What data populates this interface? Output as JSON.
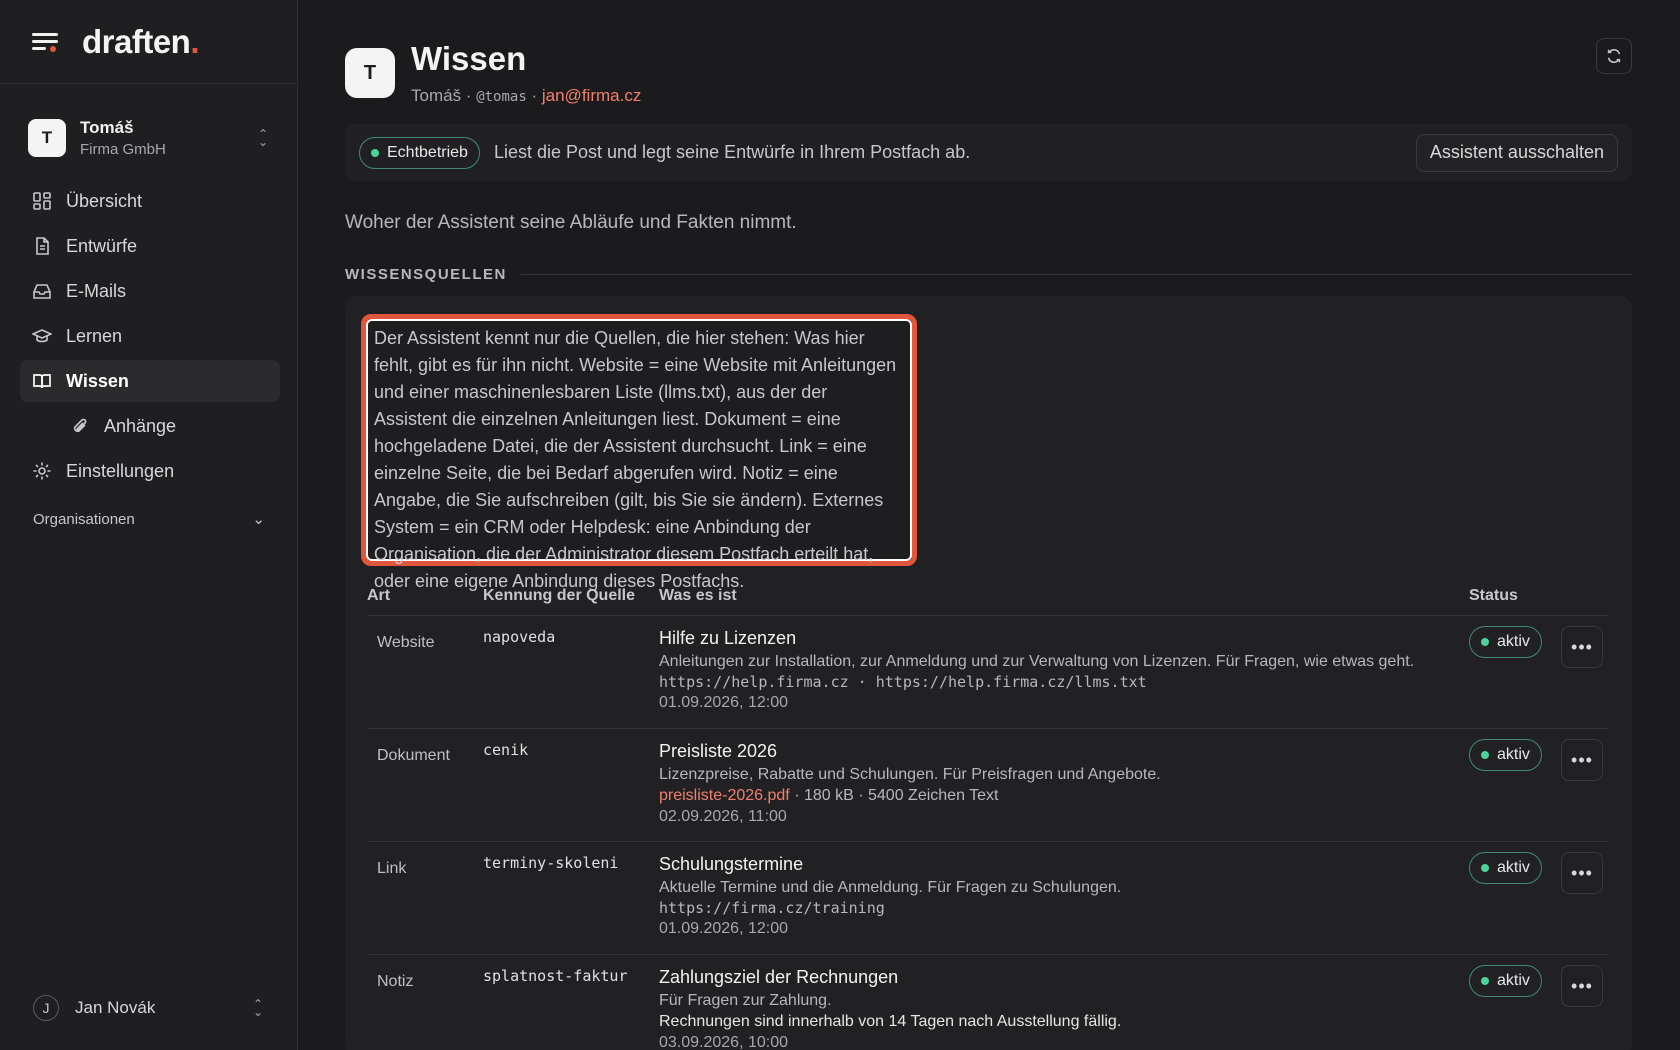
{
  "brand": {
    "name": "draften",
    "dot": "."
  },
  "org": {
    "avatar": "T",
    "name": "Tomáš",
    "sub": "Firma GmbH"
  },
  "nav": [
    {
      "label": "Übersicht",
      "icon": "grid-icon"
    },
    {
      "label": "Entwürfe",
      "icon": "document-icon"
    },
    {
      "label": "E-Mails",
      "icon": "inbox-icon"
    },
    {
      "label": "Lernen",
      "icon": "graduation-cap-icon"
    },
    {
      "label": "Wissen",
      "icon": "book-icon",
      "active": true
    },
    {
      "label": "Anhänge",
      "icon": "paperclip-icon",
      "sub": true
    },
    {
      "label": "Einstellungen",
      "icon": "gear-icon"
    }
  ],
  "organisations_label": "Organisationen",
  "user": {
    "avatar": "J",
    "name": "Jan Novák"
  },
  "header": {
    "avatar": "T",
    "title": "Wissen",
    "name": "Tomáš",
    "handle": "@tomas",
    "email": "jan@firma.cz",
    "separator": " · "
  },
  "status_bar": {
    "pill": "Echtbetrieb",
    "text": "Liest die Post und legt seine Entwürfe in Ihrem Postfach ab.",
    "button": "Assistent ausschalten"
  },
  "intro": "Woher der Assistent seine Abläufe und Fakten nimmt.",
  "section_title": "WISSENSQUELLEN",
  "callout": "Der Assistent kennt nur die Quellen, die hier stehen: Was hier fehlt, gibt es für ihn nicht. Website = eine Website mit Anleitungen und einer maschinenlesbaren Liste (llms.txt), aus der der Assistent die einzelnen Anleitungen liest. Dokument = eine hochgeladene Datei, die der Assistent durchsucht. Link = eine einzelne Seite, die bei Bedarf abgerufen wird. Notiz = eine Angabe, die Sie aufschreiben (gilt, bis Sie sie ändern). Externes System = ein CRM oder Helpdesk: eine Anbindung der Organisation, die der Administrator diesem Postfach erteilt hat, oder eine eigene Anbindung dieses Postfachs.",
  "table": {
    "headers": {
      "art": "Art",
      "key": "Kennung der Quelle",
      "what": "Was es ist",
      "status": "Status"
    },
    "rows": [
      {
        "art": "Website",
        "key": "napoveda",
        "title": "Hilfe zu Lizenzen",
        "desc": "Anleitungen zur Installation, zur Anmeldung und zur Verwaltung von Lizenzen. Für Fragen, wie etwas geht.",
        "url": "https://help.firma.cz · https://help.firma.cz/llms.txt",
        "date": "01.09.2026, 12:00",
        "status": "aktiv"
      },
      {
        "art": "Dokument",
        "key": "cenik",
        "title": "Preisliste 2026",
        "desc": "Lizenzpreise, Rabatte und Schulungen. Für Preisfragen und Angebote.",
        "file": "preisliste-2026.pdf",
        "file_meta": " · 180 kB · 5400 Zeichen Text",
        "date": "02.09.2026, 11:00",
        "status": "aktiv"
      },
      {
        "art": "Link",
        "key": "terminy-skoleni",
        "title": "Schulungstermine",
        "desc": "Aktuelle Termine und die Anmeldung. Für Fragen zu Schulungen.",
        "url": "https://firma.cz/training",
        "date": "01.09.2026, 12:00",
        "status": "aktiv"
      },
      {
        "art": "Notiz",
        "key": "splatnost-faktur",
        "title": "Zahlungsziel der Rechnungen",
        "desc": "Für Fragen zur Zahlung.",
        "note": "Rechnungen sind innerhalb von 14 Tagen nach Ausstellung fällig.",
        "date": "03.09.2026, 10:00",
        "status": "aktiv"
      }
    ]
  },
  "colors": {
    "accent": "#e2563c",
    "active_dot": "#4cd39a",
    "background": "#1b1b1d"
  }
}
